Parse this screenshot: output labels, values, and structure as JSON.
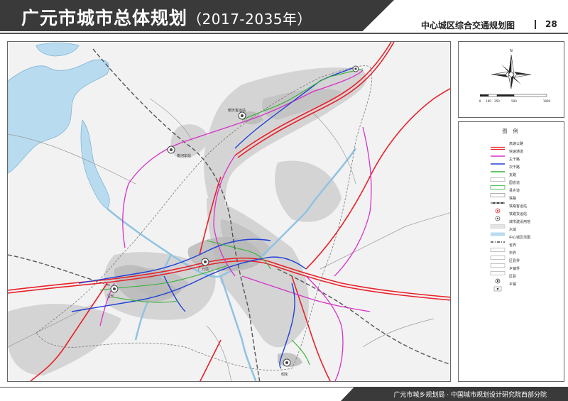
{
  "header": {
    "title": "广元市城市总体规划",
    "title_years": "（2017-2035年）",
    "subtitle": "中心城区综合交通规划图",
    "page_number": "28"
  },
  "footer": {
    "credit": "广元市城乡规划局 · 中国城市规划设计研究院西部分院"
  },
  "compass": {
    "north_label": "N",
    "scale_labels": [
      "0",
      "100",
      "250",
      "500",
      "1000"
    ]
  },
  "legend": {
    "title": "图 例",
    "items": [
      {
        "label": "高速公路",
        "kind": "double-red"
      },
      {
        "label": "快速通道",
        "kind": "magenta"
      },
      {
        "label": "主干路",
        "kind": "blue"
      },
      {
        "label": "次干路",
        "kind": "green"
      },
      {
        "label": "支路",
        "kind": "thin-gray"
      },
      {
        "label": "国省道",
        "kind": "green-outline"
      },
      {
        "label": "县乡道",
        "kind": "gray-outline"
      },
      {
        "label": "铁路",
        "kind": "rail"
      },
      {
        "label": "铁路客运站",
        "kind": "station-red"
      },
      {
        "label": "铁路货运站",
        "kind": "station-gray"
      },
      {
        "label": "城市建设用地",
        "kind": "fill-gray"
      },
      {
        "label": "水域",
        "kind": "fill-blue"
      },
      {
        "label": "中心城区范围",
        "kind": "dash-black"
      },
      {
        "label": "省界",
        "kind": "dash-gray"
      },
      {
        "label": "市界",
        "kind": "dash-gray"
      },
      {
        "label": "区县界",
        "kind": "dash-gray"
      },
      {
        "label": "乡镇界",
        "kind": "dash-gray"
      },
      {
        "label": "区县",
        "kind": "circle-dot"
      },
      {
        "label": "乡镇",
        "kind": "circle-small"
      }
    ]
  },
  "colors": {
    "expressway": "#e8222a",
    "fast_road": "#d633c8",
    "arterial": "#2342d6",
    "secondary": "#33b233",
    "water": "#b9dbef",
    "terrain": "#c8c8c8"
  },
  "map_labels": {
    "station_a": "南河车站",
    "station_b": "朝天客运站",
    "station_c": "广元站",
    "station_d": "宝轮",
    "station_e": "昭化"
  }
}
